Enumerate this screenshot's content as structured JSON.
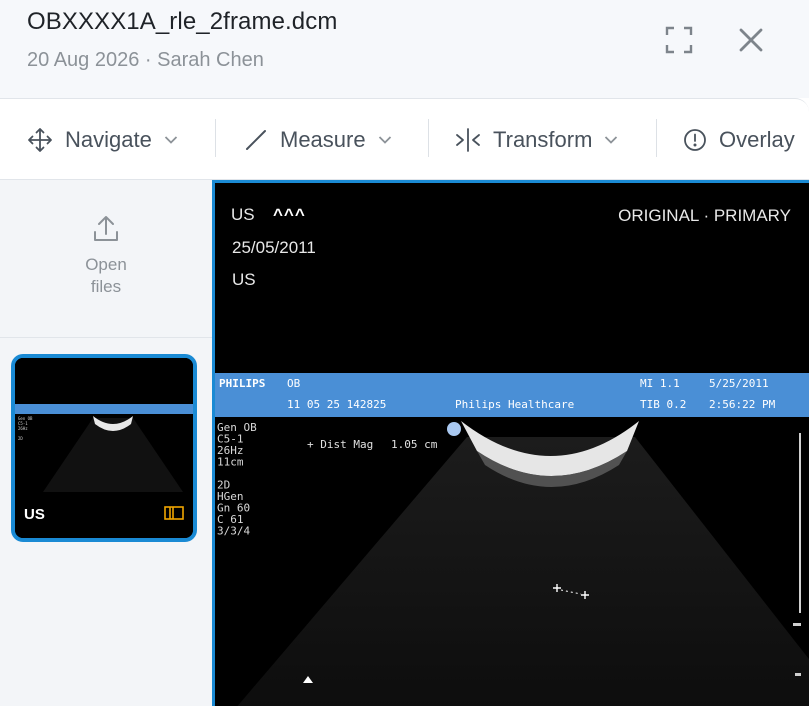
{
  "header": {
    "file_name": "OBXXXX1A_rle_2frame.dcm",
    "subtitle": "20 Aug 2026 · Sarah Chen"
  },
  "toolbar": {
    "navigate_label": "Navigate",
    "measure_label": "Measure",
    "transform_label": "Transform",
    "overlay_label": "Overlay"
  },
  "sidebar": {
    "open_files_label": "Open files",
    "thumbnail": {
      "modality": "US"
    }
  },
  "viewport": {
    "modality": "US",
    "patient_name": "^^^",
    "study_date": "25/05/2011",
    "modality_line": "US",
    "image_type": "ORIGINAL · PRIMARY",
    "burned_in": {
      "brand": "PHILIPS",
      "exam": "OB",
      "mi": "MI 1.1",
      "date": "5/25/2011",
      "id_line": "11 05 25 142825",
      "vendor": "Philips Healthcare",
      "tib": "TIB 0.2",
      "time": "2:56:22 PM",
      "left_params": [
        "Gen OB",
        "C5-1",
        "26Hz",
        "11cm",
        "",
        "2D",
        "HGen",
        "Gn 60",
        "C 61",
        "3/3/4"
      ],
      "measure_label": "+ Dist Mag",
      "measure_value": "1.05 cm"
    }
  },
  "colors": {
    "accent": "#1a8ad4",
    "thumbnail_series_icon": "#f0a500",
    "us_banner": "#4a8fd6"
  }
}
